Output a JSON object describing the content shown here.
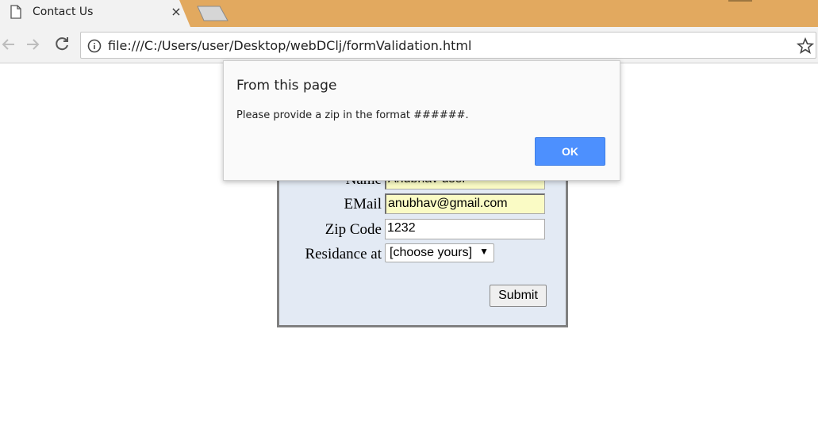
{
  "browser": {
    "tab_title": "Contact Us",
    "tab_close": "×",
    "url": "file:///C:/Users/user/Desktop/webDClj/formValidation.html",
    "colors": {
      "tabstrip": "#e2a95f",
      "toolbar": "#f2f2f2"
    }
  },
  "icons": {
    "tab": "page-icon",
    "back": "back-arrow-icon",
    "forward": "forward-arrow-icon",
    "reload": "reload-icon",
    "info": "info-icon",
    "bookmark": "star-icon"
  },
  "form": {
    "name_label": "Name",
    "name_value": "Anubhav user",
    "email_label": "EMail",
    "email_value": "anubhav@gmail.com",
    "zip_label": "Zip Code",
    "zip_value": "1232",
    "residence_label": "Residance at",
    "residence_selected": "[choose yours]",
    "submit_label": "Submit"
  },
  "dialog": {
    "title": "From this page",
    "message": "Please provide a zip in the format ######.",
    "ok_label": "OK",
    "ok_color": "#4d90fe"
  }
}
